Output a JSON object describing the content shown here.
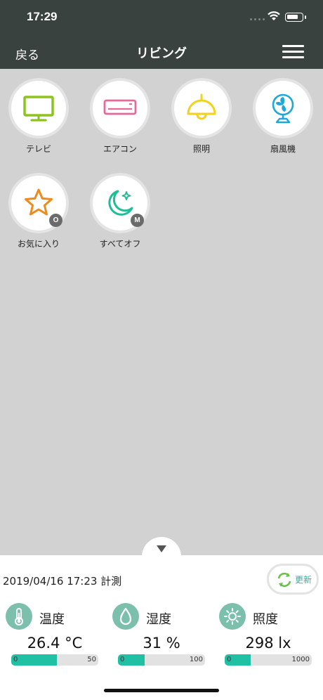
{
  "status_bar": {
    "time": "17:29"
  },
  "nav": {
    "back_label": "戻る",
    "title": "リビング"
  },
  "devices": [
    {
      "label": "テレビ",
      "icon": "tv-icon",
      "color": "#8ec31f"
    },
    {
      "label": "エアコン",
      "icon": "air-conditioner-icon",
      "color": "#e56a9a"
    },
    {
      "label": "照明",
      "icon": "lamp-icon",
      "color": "#f2d21b"
    },
    {
      "label": "扇風機",
      "icon": "fan-icon",
      "color": "#1fa7d8"
    },
    {
      "label": "お気に入り",
      "icon": "star-icon",
      "color": "#ef8a1c",
      "badge": "O"
    },
    {
      "label": "すべてオフ",
      "icon": "moon-icon",
      "color": "#1fbf95",
      "badge": "M"
    }
  ],
  "panel": {
    "measured_at": "2019/04/16 17:23 計測",
    "refresh_label": "更新",
    "accent_color": "#20c0a4",
    "sensors": [
      {
        "name": "温度",
        "icon": "thermometer-icon",
        "value": "26.4 °C",
        "min": "0",
        "max": "50",
        "fill_fraction": 0.528
      },
      {
        "name": "湿度",
        "icon": "droplet-icon",
        "value": "31 %",
        "min": "0",
        "max": "100",
        "fill_fraction": 0.31
      },
      {
        "name": "照度",
        "icon": "sun-icon",
        "value": "298 lx",
        "min": "0",
        "max": "1000",
        "fill_fraction": 0.298
      }
    ]
  }
}
